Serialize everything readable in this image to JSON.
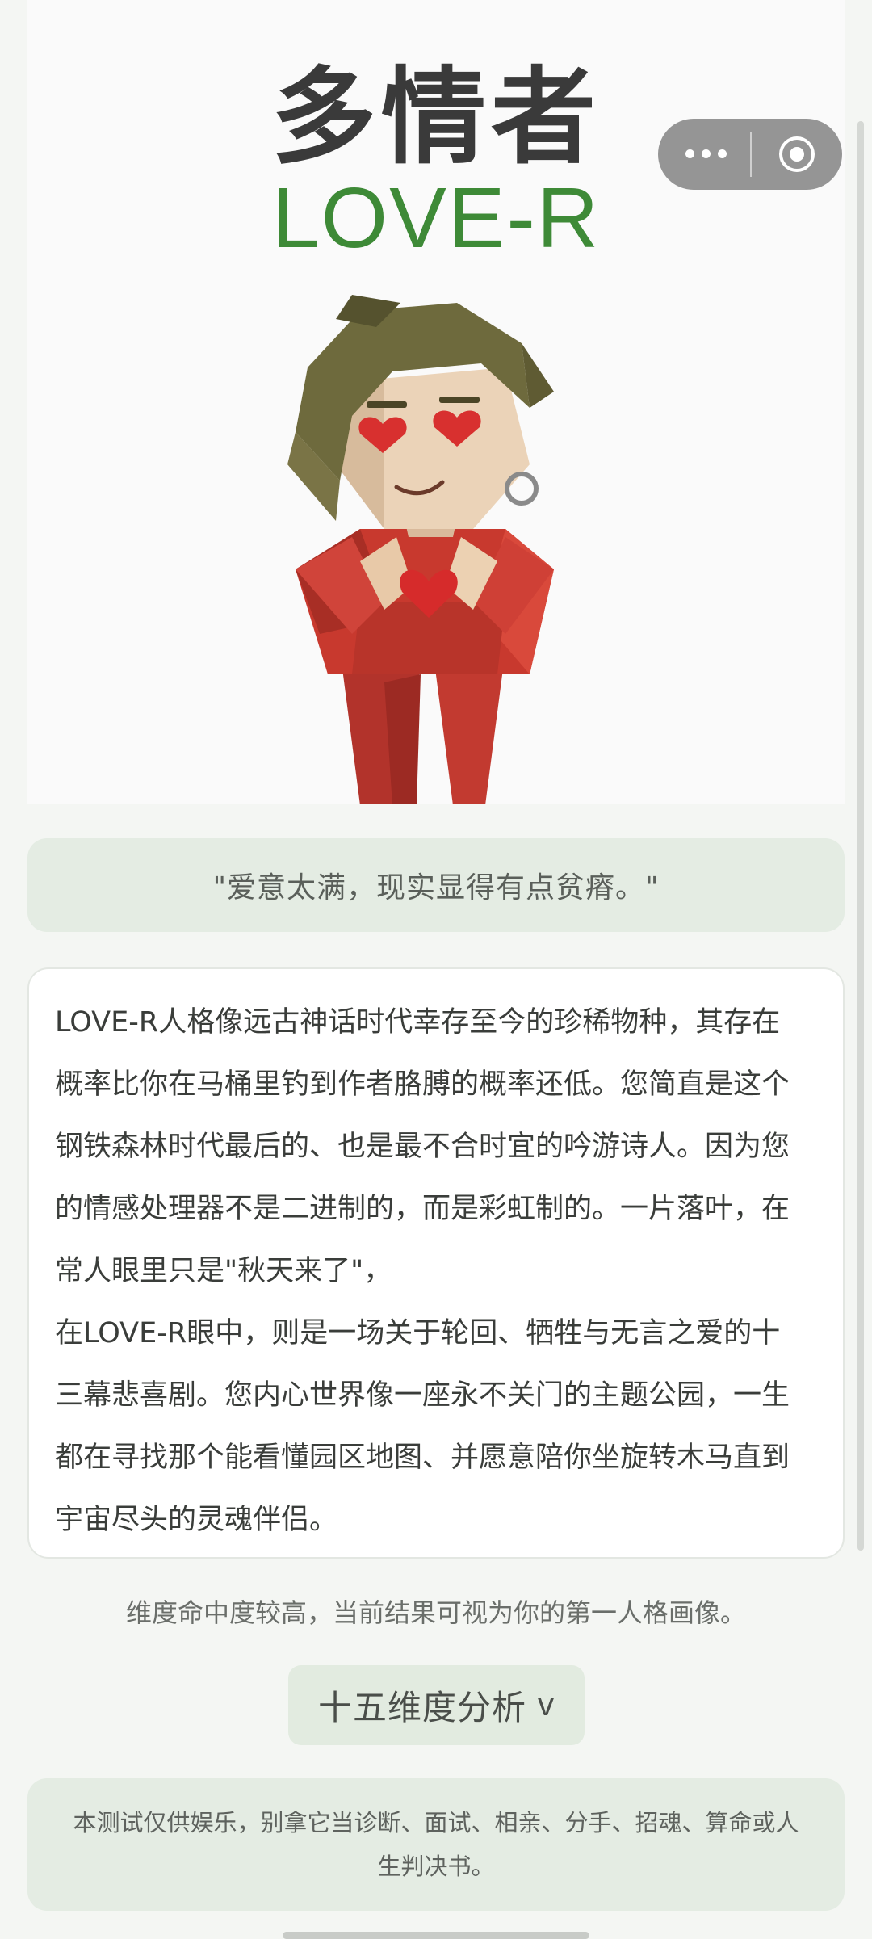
{
  "hero": {
    "title": "多情者",
    "code": "LOVE-R"
  },
  "capsule": {
    "more_icon": "more-dots-icon",
    "close_icon": "target-circle-icon"
  },
  "quote": "\"爱意太满，现实显得有点贫瘠。\"",
  "description": "LOVE-R人格像远古神话时代幸存至今的珍稀物种，其存在概率比你在马桶里钓到作者胳膊的概率还低。您简直是这个钢铁森林时代最后的、也是最不合时宜的吟游诗人。因为您的情感处理器不是二进制的，而是彩虹制的。一片落叶，在常人眼里只是\"秋天来了\"，\n在LOVE-R眼中，则是一场关于轮回、牺牲与无言之爱的十三幕悲喜剧。您内心世界像一座永不关门的主题公园，一生都在寻找那个能看懂园区地图、并愿意陪你坐旋转木马直到宇宙尽头的灵魂伴侣。",
  "hint": "维度命中度较高，当前结果可视为你的第一人格画像。",
  "analysis_button": {
    "label": "十五维度分析",
    "chevron": "v"
  },
  "disclaimer": "本测试仅供娱乐，别拿它当诊断、面试、相亲、分手、招魂、算命或人生判决书。",
  "colors": {
    "background": "#f4f6f3",
    "accent_green": "#3e8a37",
    "card_tint": "#e4ece3"
  }
}
